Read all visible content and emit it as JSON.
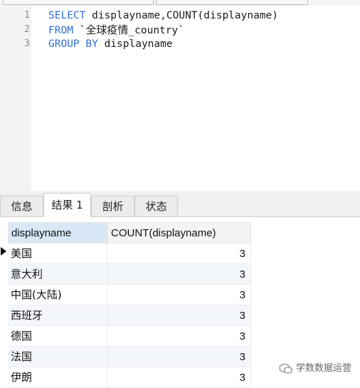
{
  "editor": {
    "lines": [
      {
        "num": "1",
        "parts": [
          [
            "kw",
            "SELECT"
          ],
          [
            "t",
            " displayname,COUNT(displayname)"
          ]
        ]
      },
      {
        "num": "2",
        "parts": [
          [
            "kw",
            "FROM"
          ],
          [
            "t",
            " `"
          ],
          [
            "cjk",
            "全球疫情"
          ],
          [
            "t",
            "_country`"
          ]
        ]
      },
      {
        "num": "3",
        "parts": [
          [
            "kw",
            "GROUP BY"
          ],
          [
            "t",
            " displayname"
          ]
        ]
      }
    ]
  },
  "tabs": [
    {
      "label": "信息",
      "active": false
    },
    {
      "label": "结果 1",
      "active": true
    },
    {
      "label": "剖析",
      "active": false
    },
    {
      "label": "状态",
      "active": false
    }
  ],
  "grid": {
    "columns": [
      "displayname",
      "COUNT(displayname)"
    ],
    "rows": [
      [
        "美国",
        "3"
      ],
      [
        "意大利",
        "3"
      ],
      [
        "中国(大陆)",
        "3"
      ],
      [
        "西班牙",
        "3"
      ],
      [
        "德国",
        "3"
      ],
      [
        "法国",
        "3"
      ],
      [
        "伊朗",
        "3"
      ]
    ]
  },
  "watermark": {
    "text": "学数数据运营"
  },
  "colors": {
    "keyword": "#2e6fd6",
    "header_selected": "#d8e8f6"
  }
}
